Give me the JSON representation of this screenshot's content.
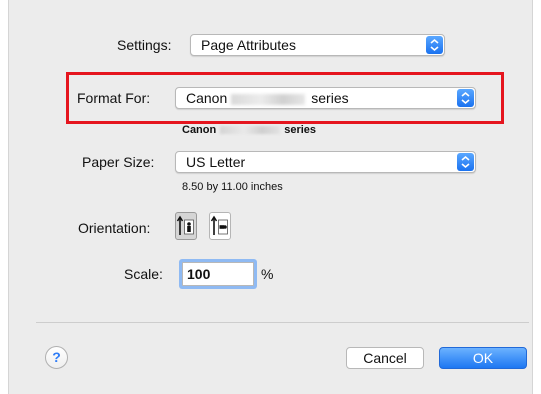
{
  "settings": {
    "label": "Settings:",
    "value": "Page Attributes"
  },
  "format_for": {
    "label": "Format For:",
    "value_prefix": "Canon",
    "value_suffix": "series",
    "caption_prefix": "Canon",
    "caption_suffix": "series"
  },
  "paper_size": {
    "label": "Paper Size:",
    "value": "US Letter",
    "caption": "8.50 by 11.00 inches"
  },
  "orientation": {
    "label": "Orientation:",
    "options": [
      "portrait",
      "landscape"
    ],
    "selected": "portrait"
  },
  "scale": {
    "label": "Scale:",
    "value": "100",
    "unit": "%"
  },
  "footer": {
    "help_label": "?",
    "cancel_label": "Cancel",
    "ok_label": "OK"
  },
  "colors": {
    "accent": "#1d77f2",
    "highlight": "#e5151e",
    "dialog_bg": "#ececec"
  },
  "icons": {
    "popup_stepper": "chevron-updown-icon",
    "portrait": "portrait-orientation-icon",
    "landscape": "landscape-orientation-icon"
  }
}
